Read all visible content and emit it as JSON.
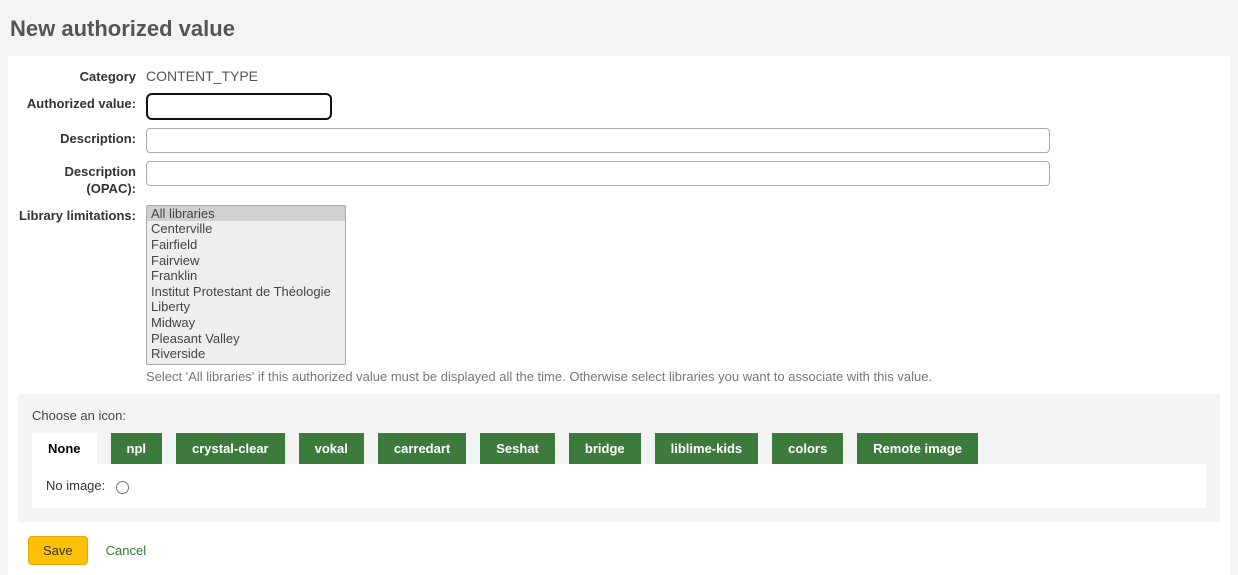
{
  "page_title": "New authorized value",
  "form": {
    "category_label": "Category",
    "category_value": "CONTENT_TYPE",
    "auth_value_label": "Authorized value:",
    "auth_value_value": "",
    "description_label": "Description:",
    "description_value": "",
    "opac_label": "Description (OPAC):",
    "opac_value": "",
    "lib_label": "Library limitations:",
    "lib_options": [
      "All libraries",
      "Centerville",
      "Fairfield",
      "Fairview",
      "Franklin",
      "Institut Protestant de Théologie",
      "Liberty",
      "Midway",
      "Pleasant Valley",
      "Riverside"
    ],
    "lib_hint": "Select 'All libraries' if this authorized value must be displayed all the time. Otherwise select libraries you want to associate with this value."
  },
  "icon_section": {
    "caption": "Choose an icon:",
    "tabs": [
      "None",
      "npl",
      "crystal-clear",
      "vokal",
      "carredart",
      "Seshat",
      "bridge",
      "liblime-kids",
      "colors",
      "Remote image"
    ],
    "active_tab": 0,
    "noimage_label": "No image:"
  },
  "actions": {
    "save": "Save",
    "cancel": "Cancel"
  },
  "colors": {
    "tab_green": "#3d7b3d",
    "save_yellow": "#ffc107",
    "link_green": "#2e7d32"
  }
}
